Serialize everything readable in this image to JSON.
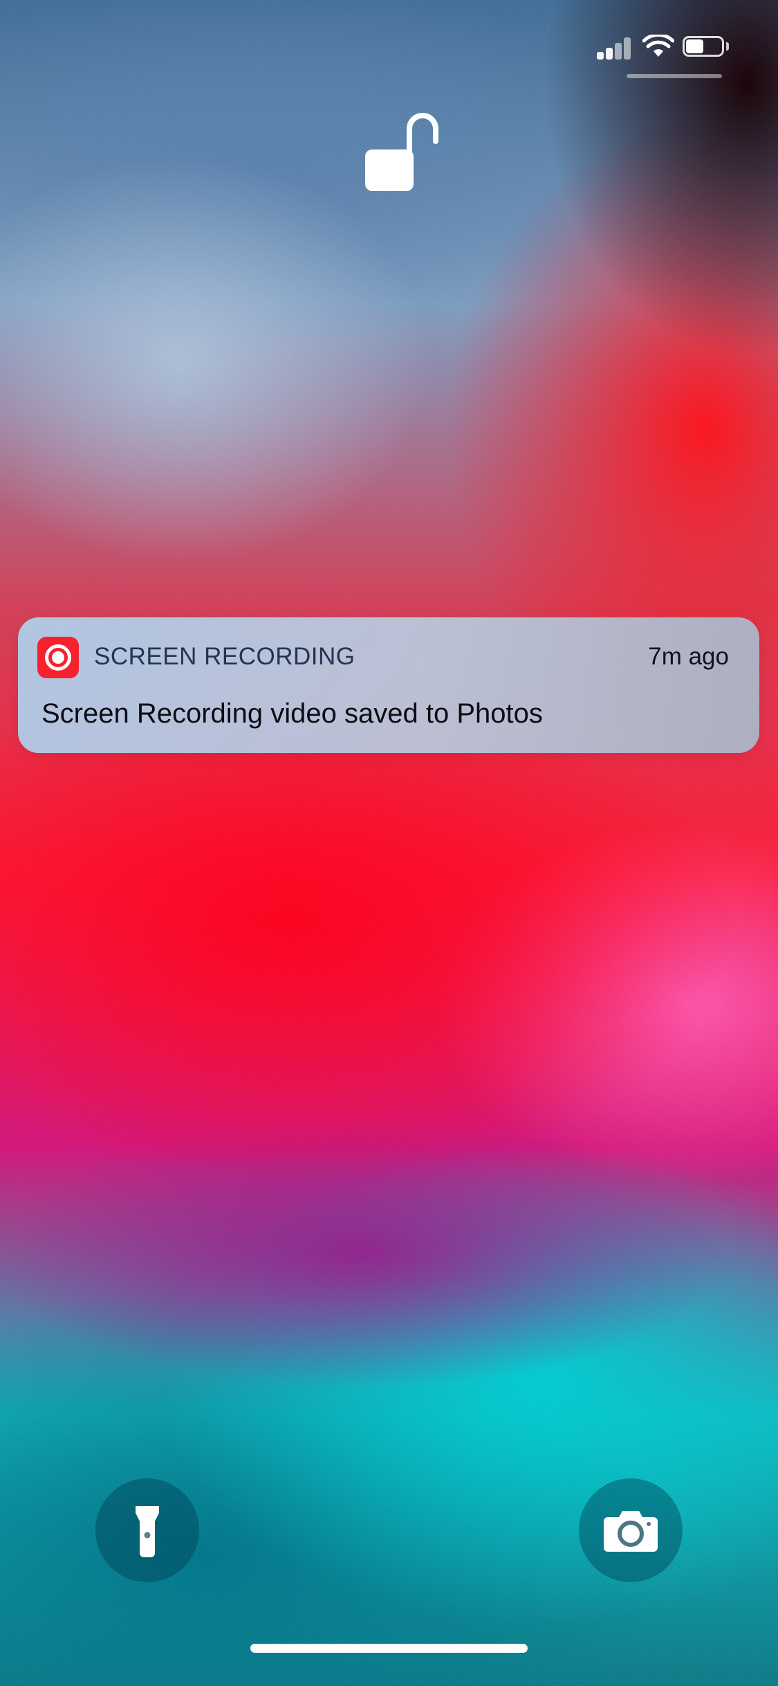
{
  "status_bar": {
    "signal_icon": "cellular-signal-icon",
    "wifi_icon": "wifi-icon",
    "battery_icon": "battery-icon",
    "battery_level": 0.5
  },
  "lock": {
    "icon": "unlocked-padlock-icon"
  },
  "notification": {
    "app_icon": "screen-recording-icon",
    "app_name": "SCREEN RECORDING",
    "time": "7m ago",
    "message": "Screen Recording video saved to Photos",
    "accent_color": "#f5212f"
  },
  "quick_actions": {
    "flashlight_icon": "flashlight-icon",
    "camera_icon": "camera-icon"
  }
}
